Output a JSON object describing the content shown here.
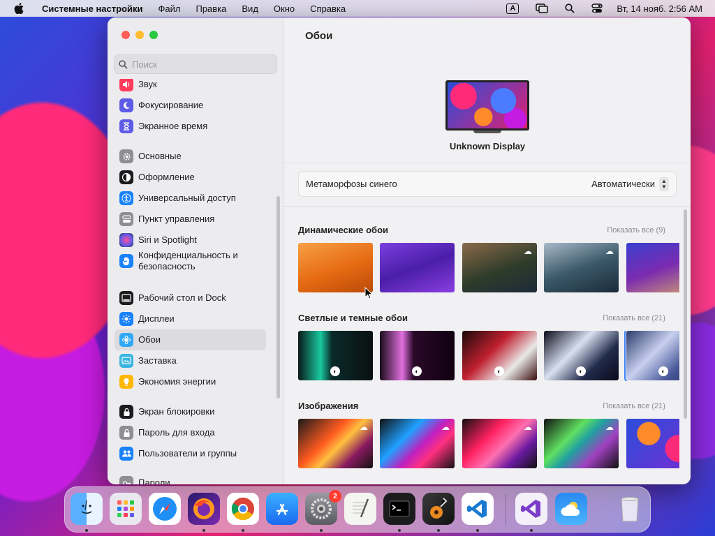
{
  "menubar": {
    "app_name": "Системные настройки",
    "menus": [
      "Файл",
      "Правка",
      "Вид",
      "Окно",
      "Справка"
    ],
    "input_source": "A",
    "clock": "Вт, 14 нояб.  2:56 AM"
  },
  "sidebar": {
    "search_placeholder": "Поиск",
    "items": [
      {
        "label": "Звук",
        "icon": "sound-icon",
        "color": "#ff3b5c"
      },
      {
        "label": "Фокусирование",
        "icon": "moon-icon",
        "color": "#5e5ce6"
      },
      {
        "label": "Экранное время",
        "icon": "hourglass-icon",
        "color": "#5e5ce6"
      },
      {
        "label": "Основные",
        "icon": "gear-icon",
        "color": "#8e8e93"
      },
      {
        "label": "Оформление",
        "icon": "appearance-icon",
        "color": "#1c1c1e"
      },
      {
        "label": "Универсальный доступ",
        "icon": "accessibility-icon",
        "color": "#1a82fb"
      },
      {
        "label": "Пункт управления",
        "icon": "control-center-icon",
        "color": "#8e8e93"
      },
      {
        "label": "Siri и Spotlight",
        "icon": "siri-icon",
        "color": "#b04cd6"
      },
      {
        "label": "Конфиденциальность и безопасность",
        "icon": "privacy-hand-icon",
        "color": "#1a82fb"
      },
      {
        "label": "Рабочий стол и Dock",
        "icon": "dock-icon",
        "color": "#1c1c1e"
      },
      {
        "label": "Дисплеи",
        "icon": "displays-icon",
        "color": "#1a82fb"
      },
      {
        "label": "Обои",
        "icon": "wallpaper-icon",
        "color": "#31a8f5"
      },
      {
        "label": "Заставка",
        "icon": "screensaver-icon",
        "color": "#39b5e0"
      },
      {
        "label": "Экономия энергии",
        "icon": "battery-icon",
        "color": "#ffb800"
      },
      {
        "label": "Экран блокировки",
        "icon": "lock-icon",
        "color": "#1c1c1e"
      },
      {
        "label": "Пароль для входа",
        "icon": "password-icon",
        "color": "#8e8e93"
      },
      {
        "label": "Пользователи и группы",
        "icon": "users-icon",
        "color": "#1a82fb"
      },
      {
        "label": "Пароли",
        "icon": "key-icon",
        "color": "#8e8e93"
      }
    ],
    "selected": "Обои"
  },
  "content": {
    "title": "Обои",
    "display_name": "Unknown Display",
    "wallpaper_name": "Метаморфозы синего",
    "wallpaper_mode": "Автоматически",
    "sections": [
      {
        "title": "Динамические обои",
        "show_all": "Показать все (9)"
      },
      {
        "title": "Светлые и темные обои",
        "show_all": "Показать все (21)"
      },
      {
        "title": "Изображения",
        "show_all": "Показать все (21)"
      }
    ]
  },
  "dock": {
    "apps": [
      "Finder",
      "Launchpad",
      "Safari",
      "Firefox",
      "Chrome",
      "App Store",
      "System Settings",
      "TextEdit",
      "Terminal",
      "GarageBand",
      "VS Code",
      "Visual Studio",
      "Weather",
      "Trash"
    ],
    "settings_badge": "2"
  },
  "colors": {
    "accent": "#3b82f6",
    "selection": "#dcdcde"
  }
}
